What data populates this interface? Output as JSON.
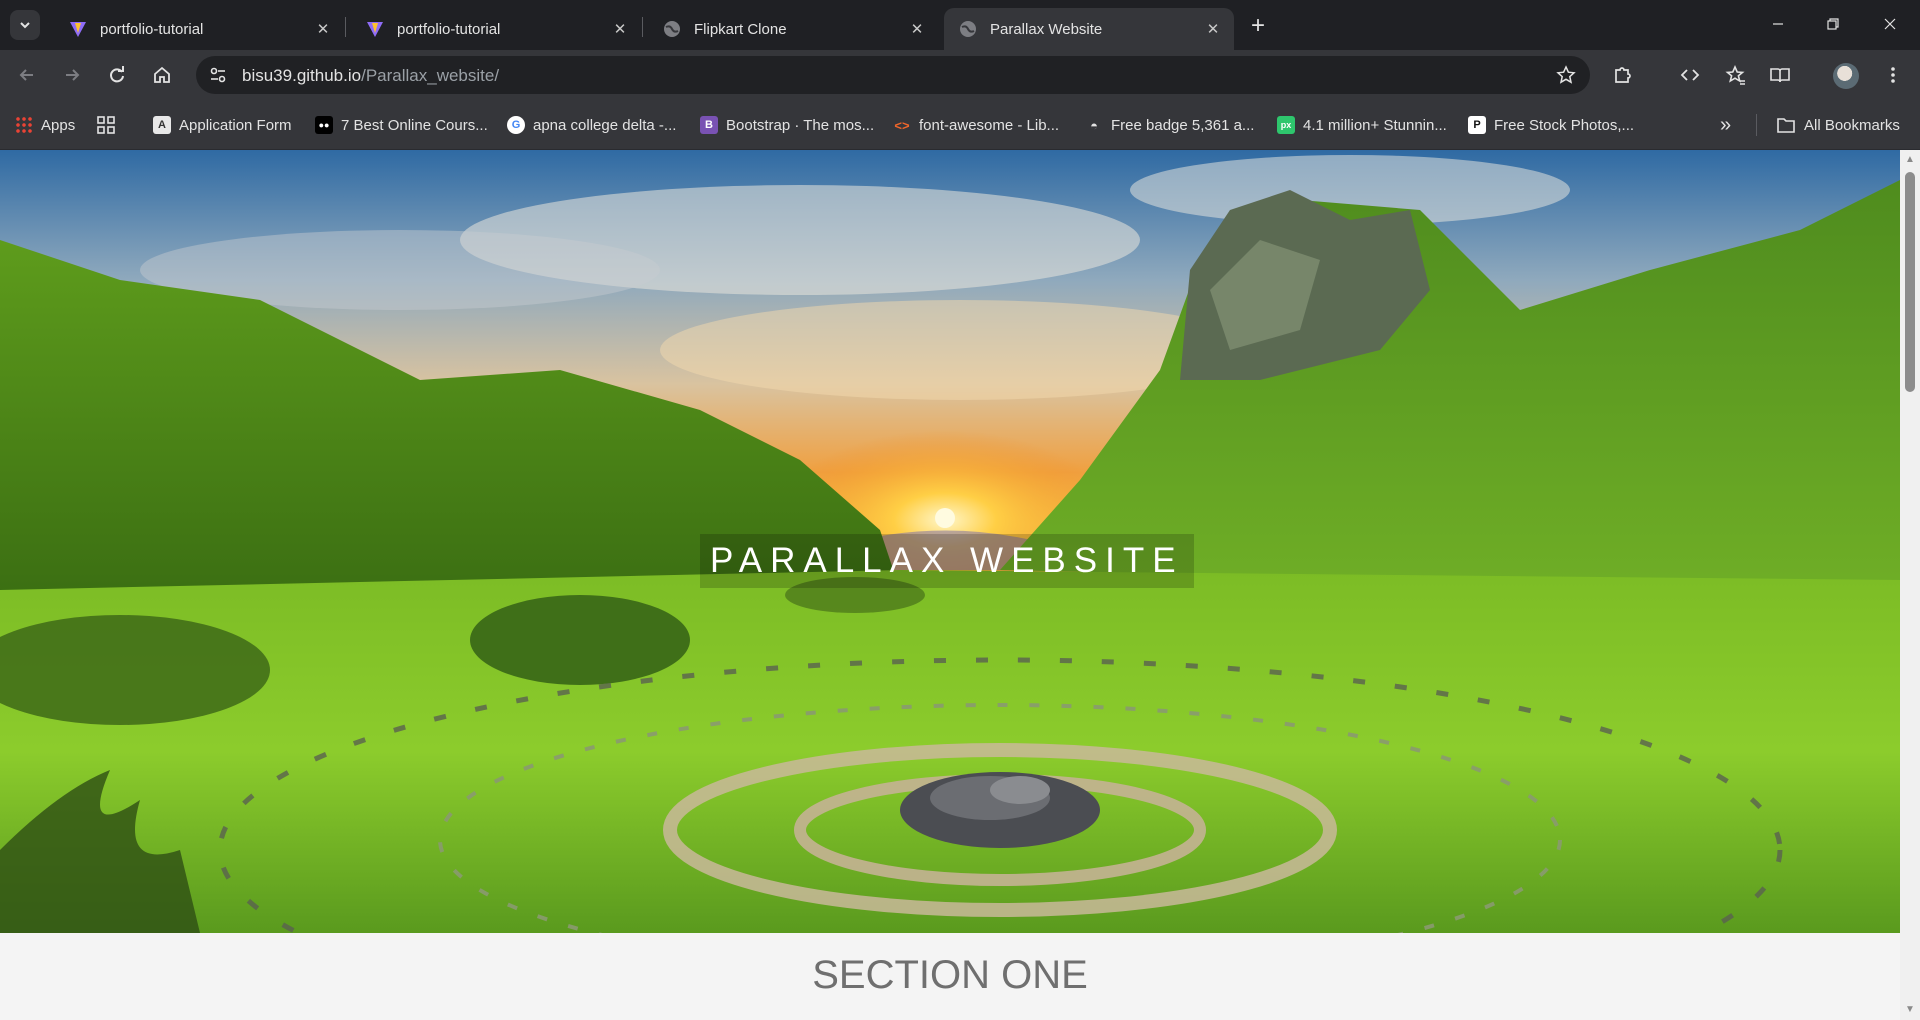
{
  "browser": {
    "tabs": [
      {
        "title": "portfolio-tutorial",
        "icon": "vite-icon",
        "active": false
      },
      {
        "title": "portfolio-tutorial",
        "icon": "vite-icon",
        "active": false
      },
      {
        "title": "Flipkart Clone",
        "icon": "globe-icon",
        "active": false
      },
      {
        "title": "Parallax Website",
        "icon": "globe-icon",
        "active": true
      }
    ],
    "tab_close_glyph": "✕",
    "new_tab_glyph": "+",
    "url_host": "bisu39.github.io",
    "url_path": "/Parallax_website/",
    "bookmarks": [
      {
        "label": "Apps",
        "icon": "apps-grid-icon"
      },
      {
        "label": "Application Form",
        "icon": "form-icon"
      },
      {
        "label": "7 Best Online Cours...",
        "icon": "medium-icon"
      },
      {
        "label": "apna college delta -...",
        "icon": "google-icon"
      },
      {
        "label": "Bootstrap · The mos...",
        "icon": "bootstrap-icon"
      },
      {
        "label": "font-awesome - Lib...",
        "icon": "code-icon"
      },
      {
        "label": "Free badge 5,361 a...",
        "icon": "badge-icon"
      },
      {
        "label": "4.1 million+ Stunnin...",
        "icon": "pixabay-icon"
      },
      {
        "label": "Free Stock Photos,...",
        "icon": "pexels-icon"
      }
    ],
    "bookmarks_overflow": "»",
    "all_bookmarks_label": "All Bookmarks",
    "colors": {
      "frame": "#1f2024",
      "toolbar": "#35363a",
      "omnibox": "#202124",
      "text": "#e3e3e3"
    }
  },
  "page": {
    "hero_title": "PARALLAX WEBSITE",
    "section_one_title": "SECTION ONE",
    "colors": {
      "section_bg": "#f4f4f4",
      "section_text": "#6f6f6f"
    }
  }
}
